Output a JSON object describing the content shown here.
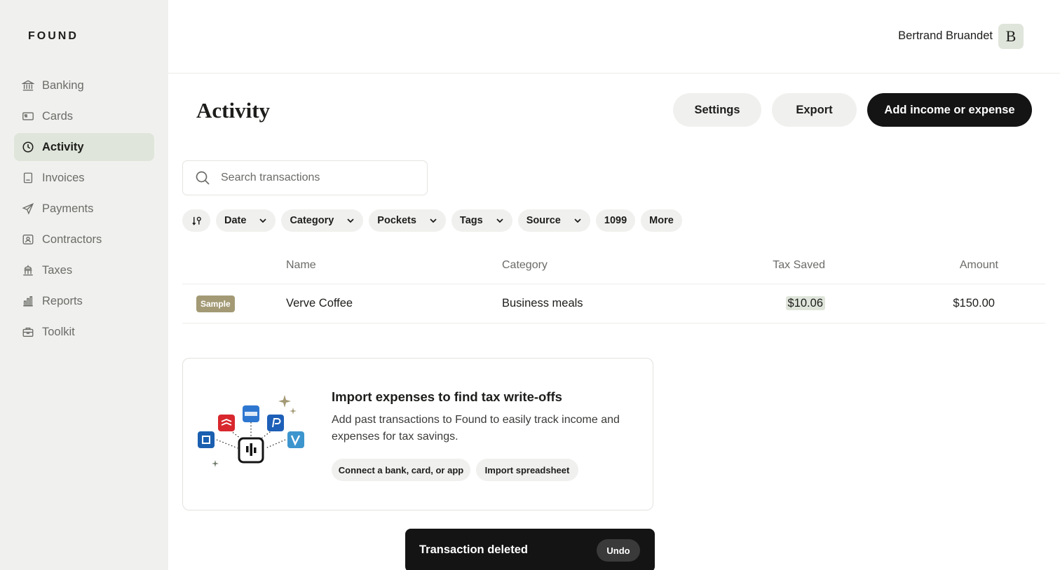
{
  "brand": {
    "logo": "FOUND"
  },
  "user": {
    "name": "Bertrand Bruandet",
    "avatar_initial": "B"
  },
  "sidebar": {
    "items": [
      {
        "label": "Banking",
        "icon": "bank-icon",
        "active": false
      },
      {
        "label": "Cards",
        "icon": "card-icon",
        "active": false
      },
      {
        "label": "Activity",
        "icon": "clock-icon",
        "active": true
      },
      {
        "label": "Invoices",
        "icon": "invoice-icon",
        "active": false
      },
      {
        "label": "Payments",
        "icon": "send-icon",
        "active": false
      },
      {
        "label": "Contractors",
        "icon": "contractor-icon",
        "active": false
      },
      {
        "label": "Taxes",
        "icon": "government-icon",
        "active": false
      },
      {
        "label": "Reports",
        "icon": "bar-chart-icon",
        "active": false
      },
      {
        "label": "Toolkit",
        "icon": "briefcase-icon",
        "active": false
      }
    ]
  },
  "page": {
    "title": "Activity",
    "settings_label": "Settings",
    "export_label": "Export",
    "add_label": "Add income or expense"
  },
  "search": {
    "placeholder": "Search transactions",
    "value": ""
  },
  "filters": {
    "sort_icon": "sort-icon",
    "chips": [
      {
        "label": "Date",
        "dropdown": true
      },
      {
        "label": "Category",
        "dropdown": true
      },
      {
        "label": "Pockets",
        "dropdown": true
      },
      {
        "label": "Tags",
        "dropdown": true
      },
      {
        "label": "Source",
        "dropdown": true
      },
      {
        "label": "1099",
        "dropdown": false
      },
      {
        "label": "More",
        "dropdown": false
      }
    ]
  },
  "table": {
    "columns": {
      "name": "Name",
      "category": "Category",
      "tax_saved": "Tax Saved",
      "amount": "Amount"
    },
    "rows": [
      {
        "badge": "Sample",
        "name": "Verve Coffee",
        "category": "Business meals",
        "tax_saved": "$10.06",
        "amount": "$150.00"
      }
    ]
  },
  "import_card": {
    "title": "Import expenses to find tax write-offs",
    "body": "Add past transactions to Found to easily track income and expenses for tax savings.",
    "connect_label": "Connect a bank, card, or app",
    "spreadsheet_label": "Import spreadsheet"
  },
  "toast": {
    "message": "Transaction deleted",
    "undo_label": "Undo"
  },
  "colors": {
    "sidebar_bg": "#f0f1ee",
    "active_nav_bg": "#dfe5da",
    "primary_button": "#141414",
    "sample_badge": "#a39a75",
    "tax_highlight": "#dfe5da"
  }
}
